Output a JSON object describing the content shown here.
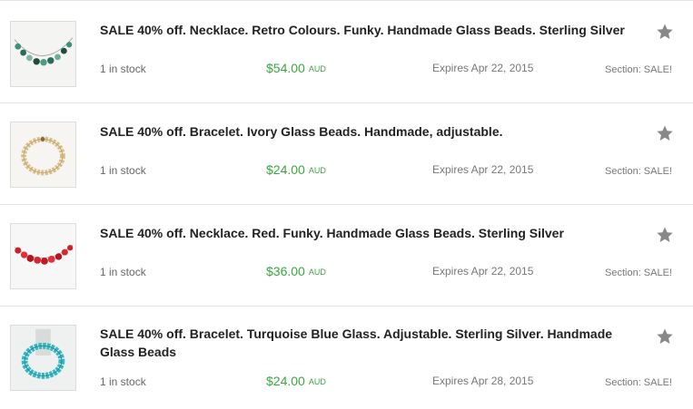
{
  "listings": [
    {
      "title": "SALE 40% off. Necklace. Retro Colours. Funky. Handmade Glass Beads. Sterling Silver",
      "stock": "1 in stock",
      "price": "$54.00",
      "currency": "AUD",
      "expires": "Expires Apr 22, 2015",
      "section": "Section: SALE!",
      "icon": "star-icon"
    },
    {
      "title": "SALE 40% off. Bracelet. Ivory Glass Beads. Handmade, adjustable.",
      "stock": "1 in stock",
      "price": "$24.00",
      "currency": "AUD",
      "expires": "Expires Apr 22, 2015",
      "section": "Section: SALE!",
      "icon": "star-icon"
    },
    {
      "title": "SALE 40% off. Necklace. Red. Funky. Handmade Glass Beads. Sterling Silver",
      "stock": "1 in stock",
      "price": "$36.00",
      "currency": "AUD",
      "expires": "Expires Apr 22, 2015",
      "section": "Section: SALE!",
      "icon": "star-icon"
    },
    {
      "title": "SALE 40% off. Bracelet. Turquoise Blue Glass. Adjustable. Sterling Silver. Handmade Glass Beads",
      "stock": "1 in stock",
      "price": "$24.00",
      "currency": "AUD",
      "expires": "Expires Apr 28, 2015",
      "section": "Section: SALE!",
      "icon": "star-icon"
    }
  ],
  "colors": {
    "price": "#3aa63f",
    "star": "#888888",
    "divider": "#e4e4e4"
  }
}
